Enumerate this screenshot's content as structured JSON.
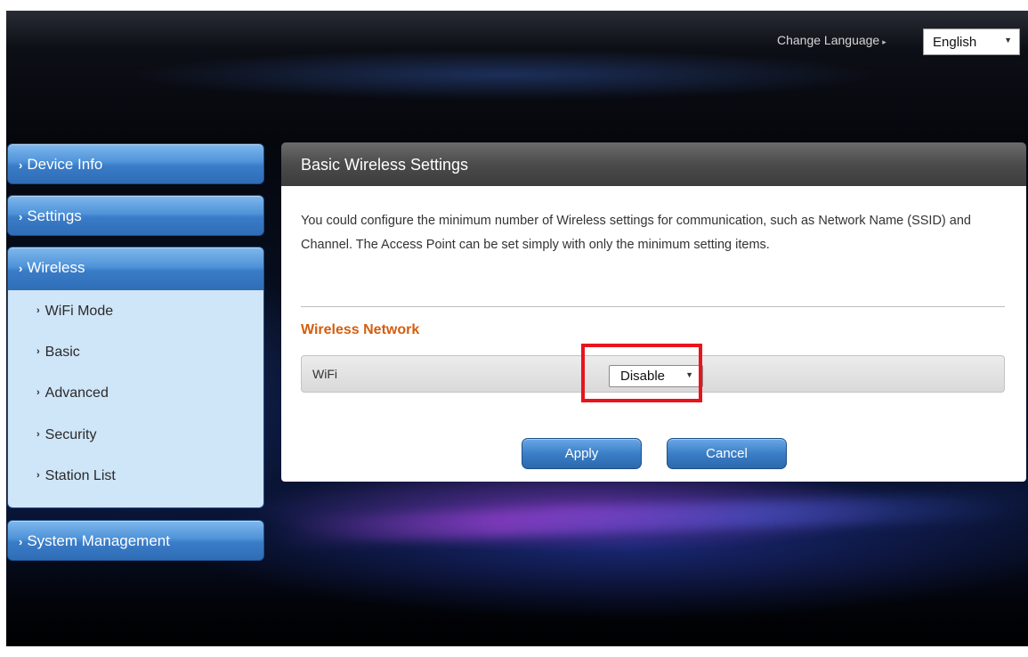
{
  "header": {
    "change_language_label": "Change Language",
    "language_selected": "English"
  },
  "sidebar": {
    "items": [
      {
        "label": "Device Info"
      },
      {
        "label": "Settings"
      },
      {
        "label": "Wireless"
      },
      {
        "label": "System Management"
      }
    ],
    "wireless_submenu": [
      {
        "label": "WiFi Mode"
      },
      {
        "label": "Basic"
      },
      {
        "label": "Advanced"
      },
      {
        "label": "Security"
      },
      {
        "label": "Station List"
      }
    ]
  },
  "main": {
    "title": "Basic Wireless Settings",
    "description": "You could configure the minimum number of Wireless settings for communication, such as Network Name (SSID) and Channel. The Access Point can be set simply with only the minimum setting items.",
    "section_title": "Wireless Network",
    "wifi_label": "WiFi",
    "wifi_value": "Disable",
    "apply_label": "Apply",
    "cancel_label": "Cancel"
  },
  "colors": {
    "accent_orange": "#d35e10",
    "highlight_red": "#e8141c",
    "button_blue": "#3b7fc7"
  }
}
